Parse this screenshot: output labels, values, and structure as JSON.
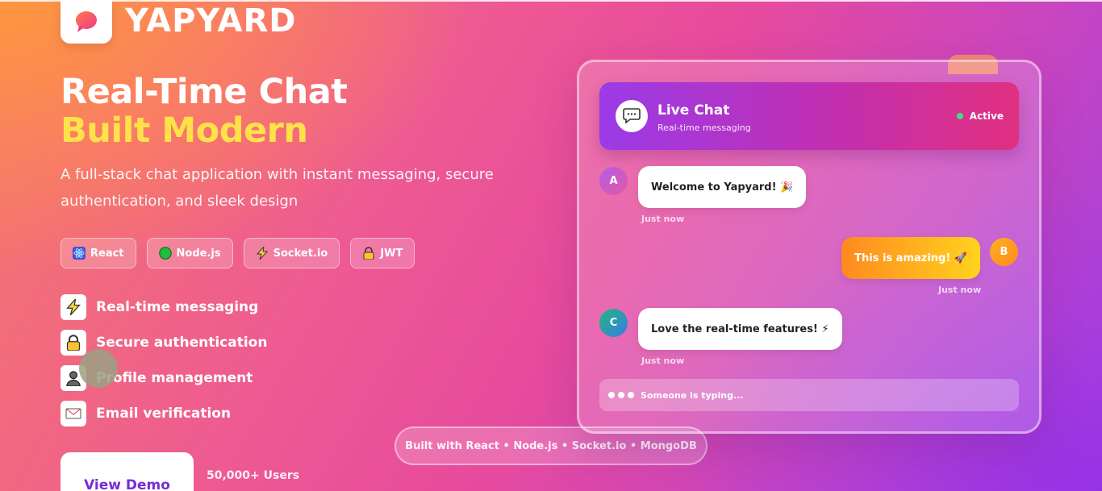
{
  "brand": {
    "name": "YAPYARD",
    "logo_icon": "chat-bubble-icon"
  },
  "hero": {
    "title_line1": "Real-Time Chat",
    "title_line2": "Built Modern",
    "subtitle": "A full-stack chat application with instant messaging, secure authentication, and sleek design"
  },
  "tech_badges": [
    {
      "label": "React",
      "icon": "atom-icon"
    },
    {
      "label": "Node.js",
      "icon": "green-circle-icon"
    },
    {
      "label": "Socket.io",
      "icon": "lightning-icon"
    },
    {
      "label": "JWT",
      "icon": "lock-icon"
    }
  ],
  "features": [
    {
      "label": "Real-time messaging",
      "icon": "lightning-icon"
    },
    {
      "label": "Secure authentication",
      "icon": "lock-icon"
    },
    {
      "label": "Profile management",
      "icon": "user-icon"
    },
    {
      "label": "Email verification",
      "icon": "envelope-icon"
    }
  ],
  "cta": {
    "demo_label": "View Demo",
    "users_label": "50,000+ Users"
  },
  "built_with": "Built with React • Node.js • Socket.io • MongoDB",
  "chat": {
    "header_title": "Live Chat",
    "header_subtitle": "Real-time messaging",
    "status": "Active",
    "messages": [
      {
        "avatar": "A",
        "text": "Welcome to Yapyard! 🎉",
        "time": "Just now"
      },
      {
        "avatar": "B",
        "text": "This is amazing! 🚀",
        "time": "Just now"
      },
      {
        "avatar": "C",
        "text": "Love the real-time features! ⚡",
        "time": "Just now"
      }
    ],
    "typing": "Someone is typing..."
  },
  "colors": {
    "accent_yellow": "#ffe14a",
    "demo_text": "#7b2bd6",
    "status_green": "#3fe07a"
  }
}
